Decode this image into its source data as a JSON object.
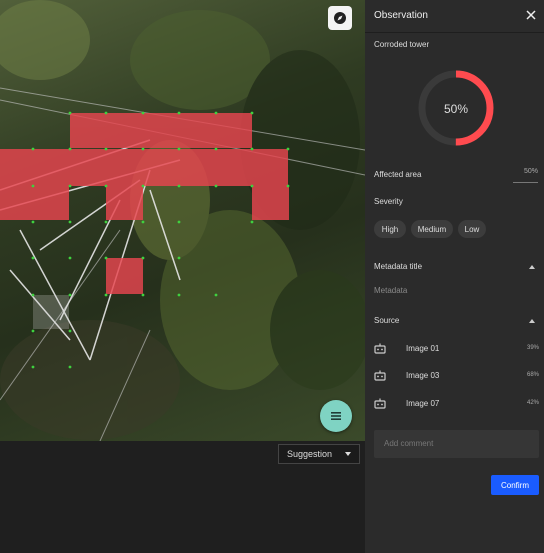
{
  "viewer": {
    "compass_icon": "compass-icon",
    "fab_icon": "menu-icon",
    "suggestion_label": "Suggestion",
    "colors": {
      "highlight": "#e8454f",
      "point": "#3fd13f",
      "fab": "#7fd3c3"
    }
  },
  "panel": {
    "title": "Observation",
    "observation_name": "Corroded tower",
    "gauge": {
      "value": 50,
      "label": "50%",
      "color": "#ff4b4f"
    },
    "affected_area_label": "Affected area",
    "affected_area_value": "50%",
    "severity_label": "Severity",
    "severity_options": [
      "High",
      "Medium",
      "Low"
    ],
    "metadata_title": "Metadata title",
    "metadata_placeholder": "Metadata",
    "source_label": "Source",
    "sources": [
      {
        "name": "Image 01",
        "percent": "39%"
      },
      {
        "name": "Image 03",
        "percent": "68%"
      },
      {
        "name": "Image 07",
        "percent": "42%"
      }
    ],
    "comment_placeholder": "Add comment",
    "confirm_label": "Confirm",
    "accent_color": "#1a5cff"
  }
}
